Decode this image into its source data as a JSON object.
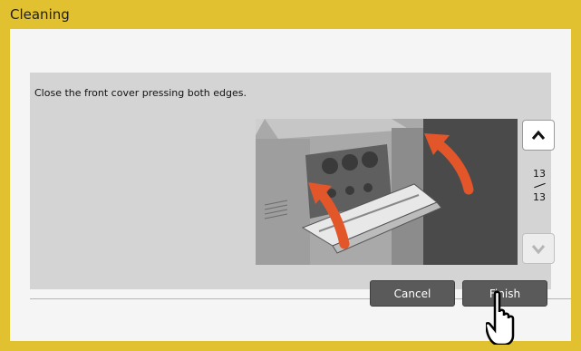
{
  "window": {
    "title": "Cleaning"
  },
  "instruction": "Close the front cover pressing both edges.",
  "pager": {
    "current": "13",
    "total": "13"
  },
  "buttons": {
    "cancel": "Cancel",
    "finish": "Finish"
  },
  "icons": {
    "up": "chevron-up-icon",
    "down": "chevron-down-icon",
    "pointer": "hand-pointer-icon"
  },
  "colors": {
    "titlebar": "#e1c12f",
    "button": "#5a5a5a",
    "arrow": "#e2562a",
    "panel": "#d4d4d4"
  }
}
